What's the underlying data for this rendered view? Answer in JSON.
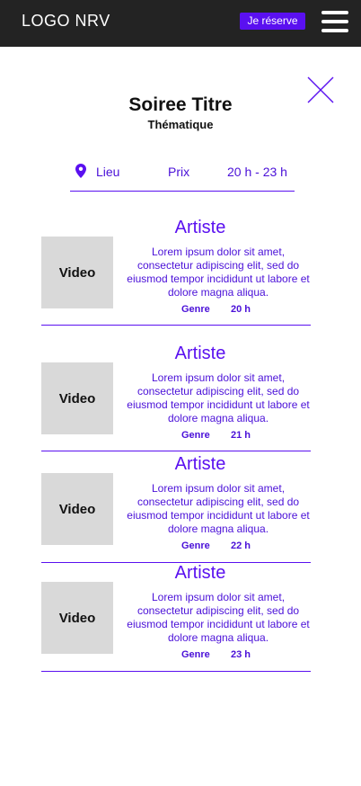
{
  "header": {
    "logo": "LOGO NRV",
    "reserve_label": "Je réserve"
  },
  "event": {
    "title": "Soiree Titre",
    "subtitle": "Thématique",
    "location_label": "Lieu",
    "price_label": "Prix",
    "hours": "20 h - 23 h"
  },
  "icons": {
    "menu": "hamburger-menu-icon",
    "close": "close-icon",
    "location": "map-pin-icon"
  },
  "colors": {
    "accent": "#5a10f0",
    "header_bg": "#232323",
    "placeholder": "#d9d9d9"
  },
  "performances": [
    {
      "video_label": "Video",
      "artist": "Artiste",
      "description": "Lorem ipsum dolor sit amet, consectetur adipiscing elit, sed do eiusmod  tempor incididunt ut labore et dolore magna aliqua.",
      "genre": "Genre",
      "time": "20 h"
    },
    {
      "video_label": "Video",
      "artist": "Artiste",
      "description": "Lorem ipsum dolor sit amet, consectetur adipiscing elit, sed do eiusmod  tempor incididunt ut labore et dolore magna aliqua.",
      "genre": "Genre",
      "time": "21 h"
    },
    {
      "video_label": "Video",
      "artist": "Artiste",
      "description": "Lorem ipsum dolor sit amet, consectetur adipiscing elit, sed do eiusmod  tempor incididunt ut labore et dolore magna aliqua.",
      "genre": "Genre",
      "time": "22 h"
    },
    {
      "video_label": "Video",
      "artist": "Artiste",
      "description": "Lorem ipsum dolor sit amet, consectetur adipiscing elit, sed do eiusmod  tempor incididunt ut labore et dolore magna aliqua.",
      "genre": "Genre",
      "time": "23 h"
    }
  ]
}
